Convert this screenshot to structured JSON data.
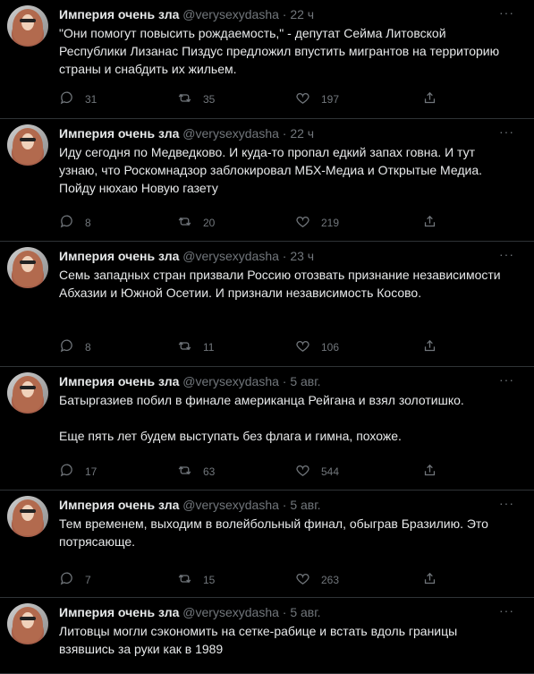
{
  "author": {
    "name": "Империя очень зла",
    "handle": "@verysexydasha",
    "separator": "·"
  },
  "more_label": "···",
  "tweets": [
    {
      "time": "22 ч",
      "text": "\"Они помогут повысить рождаемость,\" - депутат Сейма Литовской Республики Лизанас Пиздус предложил впустить мигрантов на территорию страны и снабдить их жильем.",
      "replies": "31",
      "retweets": "35",
      "likes": "197"
    },
    {
      "time": "22 ч",
      "text": "Иду сегодня по Медведково. И куда-то пропал едкий запах говна. И тут узнаю, что Роскомнадзор заблокировал МБХ-Медиа и Открытые Медиа. Пойду нюхаю Новую газету",
      "replies": "8",
      "retweets": "20",
      "likes": "219"
    },
    {
      "time": "23 ч",
      "text": "Семь западных стран призвали Россию отозвать признание независимости Абхазии и Южной Осетии. И признали независимость Косово.",
      "replies": "8",
      "retweets": "11",
      "likes": "106"
    },
    {
      "time": "5 авг.",
      "text": "Батыргазиев побил в финале американца Рейгана и взял золотишко.\n\nЕще пять лет будем выступать без флага и гимна, похоже.",
      "replies": "17",
      "retweets": "63",
      "likes": "544"
    },
    {
      "time": "5 авг.",
      "text": "Тем временем, выходим в волейбольный финал, обыграв Бразилию. Это потрясающе.",
      "replies": "7",
      "retweets": "15",
      "likes": "263"
    },
    {
      "time": "5 авг.",
      "text": "Литовцы могли сэкономить на сетке-рабице и встать вдоль границы взявшись за руки как в 1989",
      "replies": "",
      "retweets": "",
      "likes": ""
    }
  ],
  "colors": {
    "background": "#000000",
    "divider": "#2f3336",
    "text_primary": "#e7e9ea",
    "text_secondary": "#71767b"
  }
}
